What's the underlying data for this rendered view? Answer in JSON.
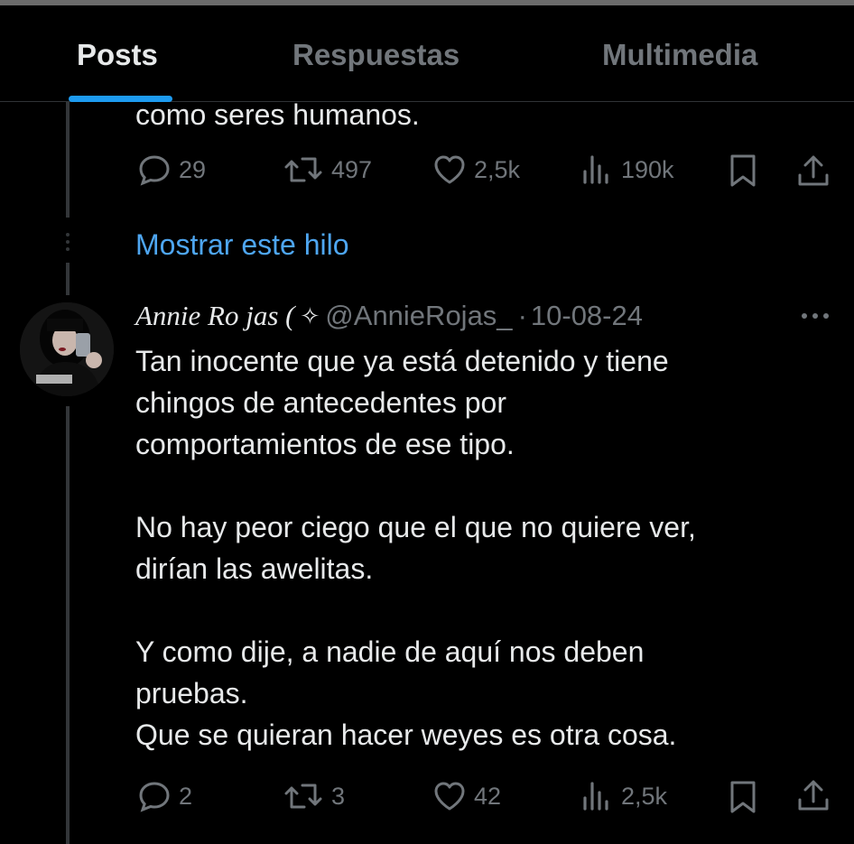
{
  "tabs": [
    {
      "label": "Posts",
      "active": true
    },
    {
      "label": "Respuestas",
      "active": false
    },
    {
      "label": "Multimedia",
      "active": false
    }
  ],
  "prev_post": {
    "text_tail": "como seres humanos.",
    "replies": "29",
    "reposts": "497",
    "likes": "2,5k",
    "views": "190k"
  },
  "show_thread": "Mostrar este hilo",
  "post": {
    "name": "Annie Ro jas (",
    "name_symbol": "✧",
    "handle": "@AnnieRojas_",
    "separator": "·",
    "date": "10-08-24",
    "text": "Tan inocente que ya está detenido y tiene\nchingos de antecedentes por\ncomportamientos de ese tipo.\n\nNo hay peor ciego que el que no quiere ver,\ndirían las awelitas.\n\nY como dije, a nadie de aquí nos deben\npruebas.\nQue se quieran hacer weyes es otra cosa.",
    "replies": "2",
    "reposts": "3",
    "likes": "42",
    "views": "2,5k"
  },
  "colors": {
    "background": "#000000",
    "text": "#e7e9ea",
    "muted": "#71767b",
    "accent": "#1d9bf0",
    "link": "#4ea6f1"
  },
  "icons": [
    "reply-icon",
    "repost-icon",
    "like-icon",
    "views-icon",
    "bookmark-icon",
    "share-icon",
    "more-icon"
  ]
}
